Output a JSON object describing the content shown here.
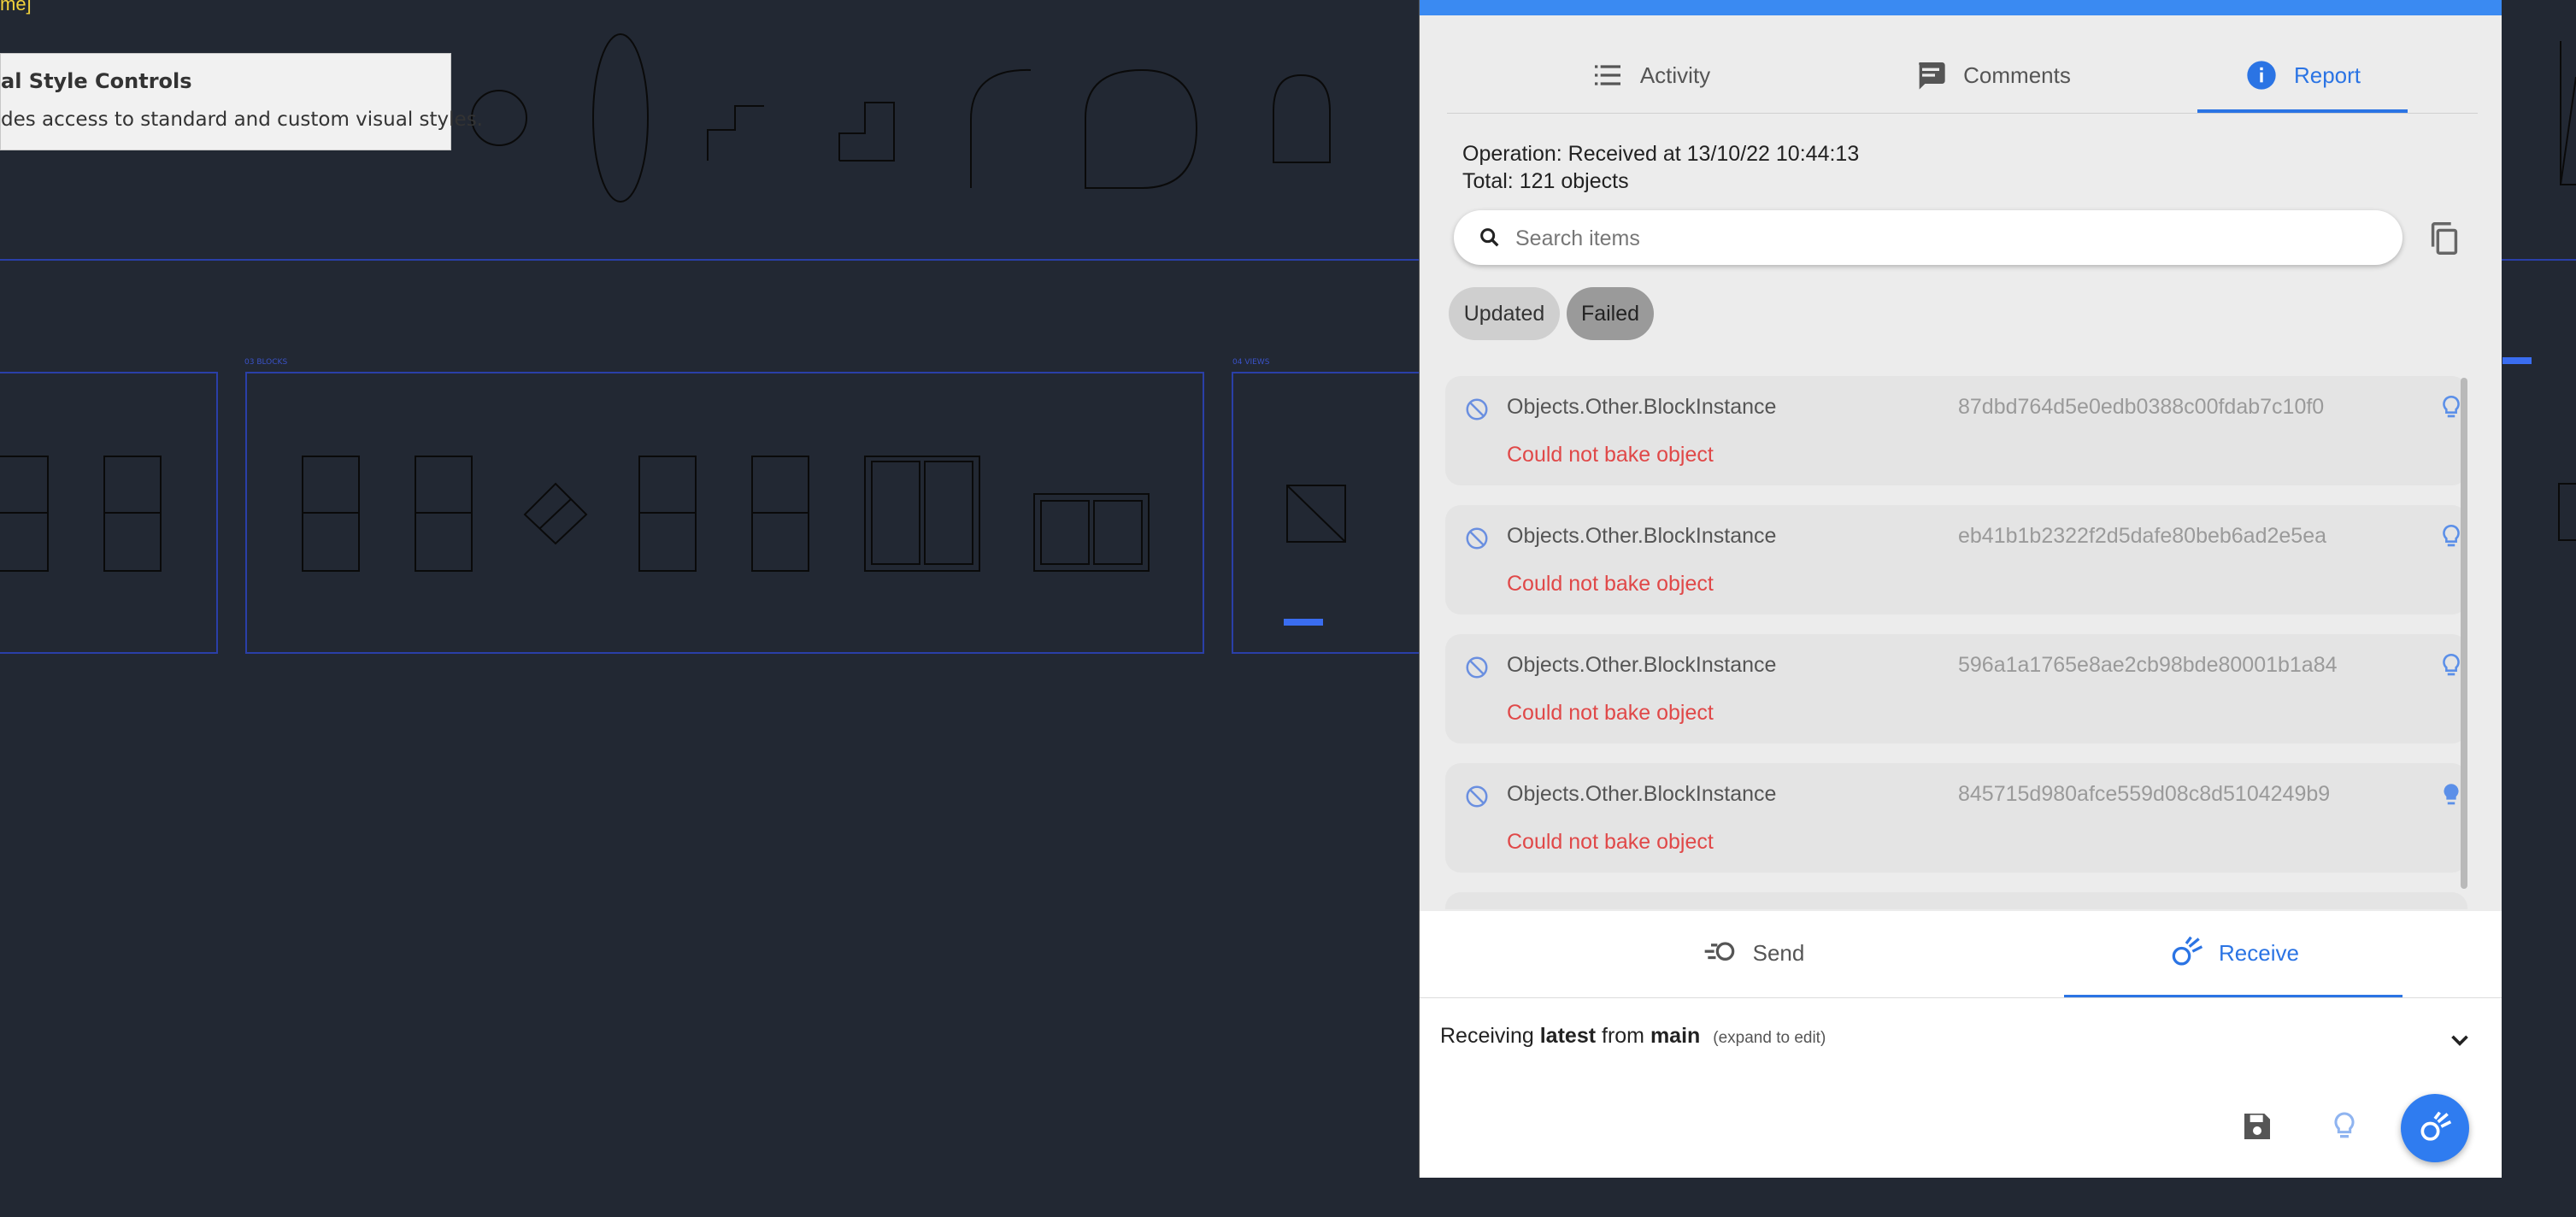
{
  "background": {
    "command_text": "me]",
    "tooltip": {
      "title": "al Style Controls",
      "description": "des access to standard and custom visual styles."
    },
    "blocks_label": "03 BLOCKS",
    "views_label": "04 VIEWS"
  },
  "panel": {
    "tabs": [
      {
        "label": "Activity",
        "icon": "activity-list-icon"
      },
      {
        "label": "Comments",
        "icon": "comments-icon"
      },
      {
        "label": "Report",
        "icon": "info-icon",
        "active": true
      }
    ],
    "operation_line": "Operation: Received at 13/10/22 10:44:13",
    "total_line": "Total: 121 objects",
    "search": {
      "placeholder": "Search items",
      "value": ""
    },
    "filters": [
      {
        "label": "Updated",
        "selected": false
      },
      {
        "label": "Failed",
        "selected": true
      }
    ],
    "items": [
      {
        "type": "Objects.Other.BlockInstance",
        "id": "87dbd764d5e0edb0388c00fdab7c10f0",
        "error": "Could not bake object"
      },
      {
        "type": "Objects.Other.BlockInstance",
        "id": "eb41b1b2322f2d5dafe80beb6ad2e5ea",
        "error": "Could not bake object"
      },
      {
        "type": "Objects.Other.BlockInstance",
        "id": "596a1a1765e8ae2cb98bde80001b1a84",
        "error": "Could not bake object"
      },
      {
        "type": "Objects.Other.BlockInstance",
        "id": "845715d980afce559d08c8d5104249b9",
        "error": "Could not bake object"
      }
    ],
    "bottom": {
      "tabs": [
        {
          "label": "Send",
          "icon": "send-icon"
        },
        {
          "label": "Receive",
          "icon": "receive-icon",
          "active": true
        }
      ],
      "receiving": {
        "prefix": "Receiving",
        "version": "latest",
        "from": "from",
        "branch": "main",
        "hint": "(expand to edit)"
      }
    },
    "colors": {
      "accent": "#2b74e4",
      "error": "#e04848",
      "topbar": "#3a8af2"
    }
  }
}
